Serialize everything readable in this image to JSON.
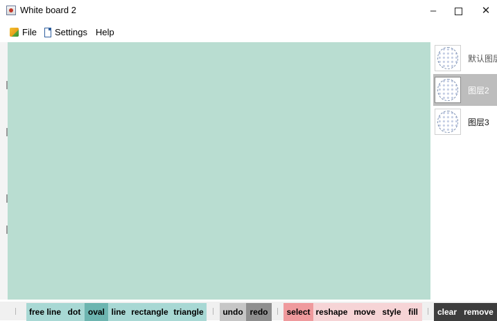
{
  "window": {
    "title": "White board 2",
    "minimize_glyph": "–",
    "close_glyph": "✕"
  },
  "menu": {
    "items": [
      {
        "label": "File",
        "icon": "file-icon"
      },
      {
        "label": "Settings",
        "icon": "document-icon"
      },
      {
        "label": "Help"
      }
    ]
  },
  "canvas": {
    "background": "#b9ddd1"
  },
  "layers": [
    {
      "label": "默认图层",
      "selected": false
    },
    {
      "label": "图层2",
      "selected": true
    },
    {
      "label": "图层3",
      "selected": false
    }
  ],
  "toolbar": {
    "draw_tools": [
      "free line",
      "dot",
      "oval",
      "line",
      "rectangle",
      "triangle"
    ],
    "history_tools": [
      "undo",
      "redo"
    ],
    "edit_tools": [
      "select",
      "reshape",
      "move",
      "style",
      "fill"
    ],
    "layer_tools": [
      "clear",
      "remove"
    ],
    "colors": {
      "draw": "#a8d8d4",
      "draw_active": "#6db5b0",
      "history": "#c6c6c6",
      "history_dark": "#8f8f8f",
      "edit": "#f6d4d6",
      "edit_active": "#ef9a9d",
      "layer": "#3d3d3d"
    }
  }
}
